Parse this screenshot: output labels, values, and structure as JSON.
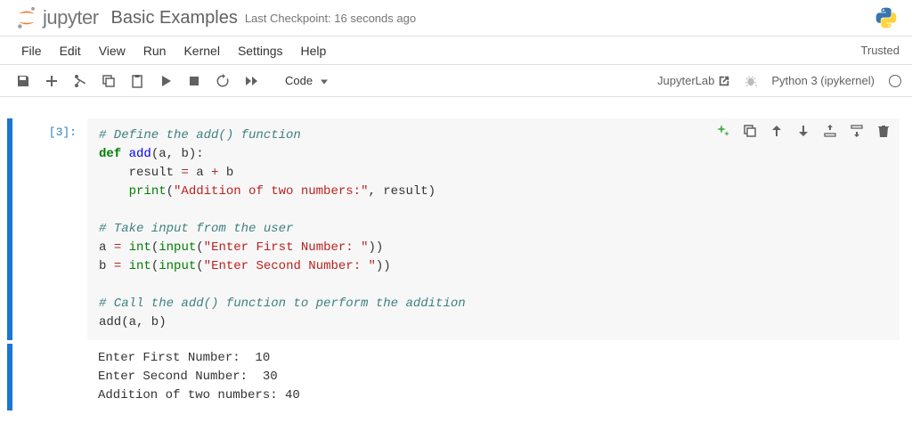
{
  "header": {
    "logo_text": "jupyter",
    "title": "Basic Examples",
    "checkpoint": "Last Checkpoint: 16 seconds ago"
  },
  "menubar": {
    "items": [
      "File",
      "Edit",
      "View",
      "Run",
      "Kernel",
      "Settings",
      "Help"
    ],
    "trusted": "Trusted"
  },
  "toolbar": {
    "cell_type": "Code",
    "jupyterlab": "JupyterLab",
    "kernel_label": "Python 3 (ipykernel)"
  },
  "cell": {
    "prompt": "[3]:",
    "code": {
      "line1_comment": "# Define the add() function",
      "line2_def": "def",
      "line2_fn": "add",
      "line2_rest": "(a, b):",
      "line3_a": "    result ",
      "line3_eq": "=",
      "line3_b": " a ",
      "line3_plus": "+",
      "line3_c": " b",
      "line4_a": "    ",
      "line4_print": "print",
      "line4_b": "(",
      "line4_str": "\"Addition of two numbers:\"",
      "line4_c": ", result)",
      "line6_comment": "# Take input from the user",
      "line7_a": "a ",
      "line7_eq": "=",
      "line7_b": " ",
      "line7_int": "int",
      "line7_c": "(",
      "line7_input": "input",
      "line7_d": "(",
      "line7_str": "\"Enter First Number: \"",
      "line7_e": "))",
      "line8_a": "b ",
      "line8_eq": "=",
      "line8_b": " ",
      "line8_int": "int",
      "line8_c": "(",
      "line8_input": "input",
      "line8_d": "(",
      "line8_str": "\"Enter Second Number: \"",
      "line8_e": "))",
      "line10_comment": "# Call the add() function to perform the addition",
      "line11": "add(a, b)"
    },
    "output": "Enter First Number:  10\nEnter Second Number:  30\nAddition of two numbers: 40"
  }
}
